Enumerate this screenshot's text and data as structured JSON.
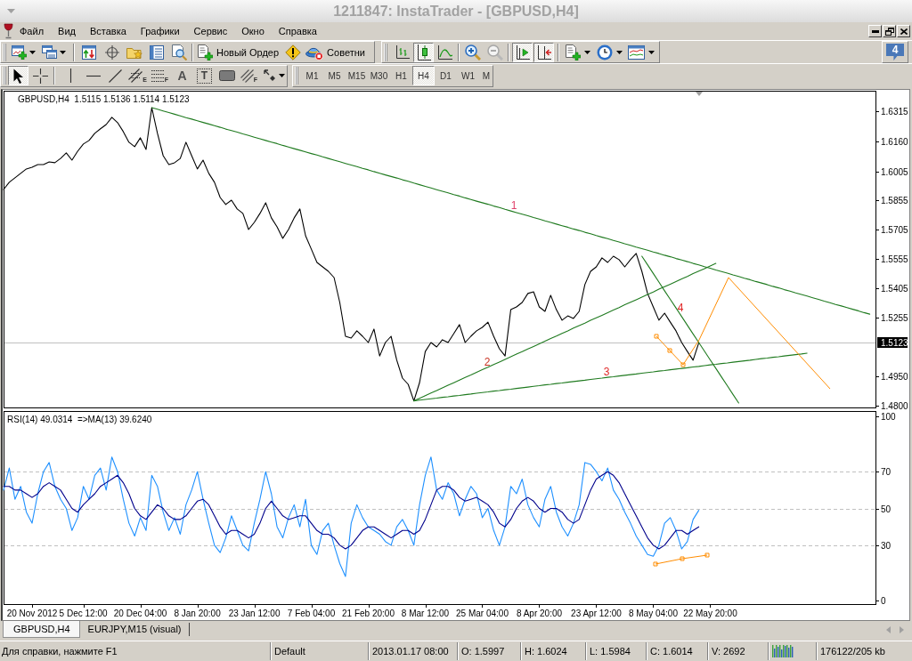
{
  "window": {
    "title": "1211847: InstaTrader - [GBPUSD,H4]"
  },
  "menu": [
    "Файл",
    "Вид",
    "Вставка",
    "Графики",
    "Сервис",
    "Окно",
    "Справка"
  ],
  "standard_toolbar": {
    "new_order": "Новый Ордер",
    "expert_advisors": "Советни"
  },
  "chart_toolbar": {
    "chart_types": [
      {
        "selected": false
      },
      {
        "selected": true
      },
      {
        "selected": false
      }
    ],
    "chart_shift": {
      "on": true
    },
    "autoscroll": {
      "on": true
    }
  },
  "notifications": {
    "count": "4"
  },
  "drawing_tools": [
    {
      "selected": true
    },
    {
      "selected": false
    },
    {
      "selected": false
    },
    {
      "selected": false
    },
    {
      "selected": false
    },
    {
      "selected": false,
      "glyph": "E"
    },
    {
      "selected": false,
      "glyph": "F"
    },
    {
      "selected": false,
      "glyph": "A"
    },
    {
      "selected": false,
      "glyph": "T"
    },
    {
      "selected": false
    },
    {
      "selected": false,
      "glyph": "F"
    },
    {
      "selected": false
    }
  ],
  "periods": [
    {
      "label": "M1",
      "selected": false
    },
    {
      "label": "M5",
      "selected": false
    },
    {
      "label": "M15",
      "selected": false
    },
    {
      "label": "M30",
      "selected": false
    },
    {
      "label": "H1",
      "selected": false
    },
    {
      "label": "H4",
      "selected": true
    },
    {
      "label": "D1",
      "selected": false
    },
    {
      "label": "W1",
      "selected": false
    },
    {
      "label": "M",
      "selected": false
    }
  ],
  "chart": {
    "chart_data": [
      {
        "type": "line",
        "title": "GBPUSD,H4  1.5115 1.5136 1.5114 1.5123",
        "ylim": [
          1.4791,
          1.642
        ],
        "yticks": [
          {
            "value": 1.48,
            "label": "1.4800"
          },
          {
            "value": 1.495,
            "label": "1.4950"
          },
          1.5255,
          1.5405,
          1.5555,
          1.5705,
          1.5855,
          1.6005,
          {
            "value": 1.616,
            "label": "1.6160"
          },
          1.6315
        ],
        "ref_lines": [
          {
            "axis": "y",
            "value": 1.5123,
            "label": "1.5123",
            "color": "#c0c0c0"
          }
        ],
        "annotations": [
          "1",
          "2",
          "3",
          "4"
        ],
        "categories": [
          null,
          null,
          null,
          null,
          null,
          null,
          null,
          null,
          null,
          null,
          null,
          null,
          null,
          null,
          null,
          null,
          null,
          null,
          null,
          null,
          null,
          null,
          null,
          null,
          null,
          null,
          null,
          null,
          null,
          null,
          null,
          null,
          null,
          null,
          null,
          null,
          null,
          null,
          null,
          null,
          null,
          null,
          null,
          null,
          null,
          null,
          null,
          null,
          null,
          null,
          null,
          null,
          null,
          null,
          null,
          null,
          null,
          null,
          null,
          null,
          null,
          null,
          null,
          null,
          null,
          null,
          null,
          null,
          null,
          null,
          null,
          null,
          null,
          null,
          null,
          null,
          null,
          null,
          null,
          null,
          null,
          null,
          null,
          null,
          null,
          null,
          null,
          null,
          null,
          null,
          null,
          null,
          null,
          null,
          null,
          null,
          null,
          null,
          null,
          null,
          null,
          null,
          null,
          null,
          null,
          null,
          null,
          null,
          null,
          null,
          null,
          null,
          null,
          null,
          null,
          null,
          null,
          null,
          null,
          null,
          null,
          null,
          null,
          null,
          null,
          null,
          null,
          null,
          null,
          null,
          null,
          null,
          null,
          null,
          null,
          null,
          null,
          null,
          null,
          null,
          null,
          null,
          null,
          null,
          null,
          null,
          null,
          null,
          null,
          null,
          null,
          null,
          null
        ],
        "series": [
          {
            "color": "#000000",
            "values": [
              1.5912,
              1.5949,
              1.5972,
              1.5995,
              1.6018,
              1.6027,
              1.604,
              1.604,
              1.6054,
              1.605,
              1.6072,
              1.61,
              1.6063,
              1.6109,
              1.6146,
              1.6164,
              1.6201,
              1.6224,
              1.6246,
              1.6283,
              1.6256,
              1.621,
              1.6155,
              1.6132,
              1.6178,
              1.6118,
              1.6333,
              1.6201,
              1.6086,
              1.604,
              1.605,
              1.6072,
              1.6155,
              1.6086,
              1.6018,
              1.6063,
              1.5995,
              1.5949,
              1.5871,
              1.5835,
              1.5857,
              1.5812,
              1.5789,
              1.5706,
              1.5743,
              1.5789,
              1.5844,
              1.5766,
              1.572,
              1.5661,
              1.5706,
              1.5766,
              1.5812,
              1.5674,
              1.5606,
              1.5537,
              1.5514,
              1.5491,
              1.5459,
              1.5331,
              1.5157,
              1.5148,
              1.5185,
              1.5157,
              1.5125,
              1.5194,
              1.5056,
              1.5125,
              1.5157,
              1.5034,
              1.4942,
              1.491,
              1.4825,
              1.4919,
              1.5079,
              1.5125,
              1.5102,
              1.5139,
              1.5125,
              1.5171,
              1.5217,
              1.5125,
              1.5157,
              1.5185,
              1.5203,
              1.523,
              1.5157,
              1.5093,
              1.5056,
              1.5294,
              1.5308,
              1.5331,
              1.5377,
              1.5386,
              1.5308,
              1.5285,
              1.5368,
              1.5294,
              1.524,
              1.5262,
              1.5249,
              1.5285,
              1.5423,
              1.5491,
              1.5514,
              1.556,
              1.5537,
              1.5569,
              1.5551,
              1.5514,
              1.5551,
              1.5583,
              1.5491,
              1.5377,
              1.5308,
              1.524,
              1.5276,
              1.523,
              1.5185,
              1.5125,
              1.5079,
              1.5034,
              1.5123,
              null,
              null,
              null,
              null,
              null,
              null,
              null,
              null,
              null,
              null,
              null,
              null,
              null,
              null,
              null,
              null,
              null,
              null,
              null,
              null,
              null,
              null,
              null,
              null,
              null,
              null,
              null,
              null,
              null,
              null
            ]
          },
          {
            "type": "line",
            "color": "#1f7a1f",
            "values": [
              null,
              null,
              null,
              null,
              null,
              null,
              null,
              null,
              null,
              null,
              null,
              null,
              null,
              null,
              null,
              null,
              null,
              null,
              null,
              null,
              null,
              null,
              null,
              null,
              null,
              null,
              1.6333,
              1.6325,
              1.6316,
              1.6308,
              1.6299,
              1.6291,
              1.6282,
              1.6274,
              1.6266,
              1.6257,
              1.6249,
              1.624,
              1.6232,
              1.6223,
              1.6215,
              1.6207,
              1.6198,
              1.619,
              1.6181,
              1.6173,
              1.6164,
              1.6156,
              1.6148,
              1.6139,
              1.6131,
              1.6122,
              1.6114,
              1.6105,
              1.6097,
              1.6089,
              1.608,
              1.6072,
              1.6063,
              1.6055,
              1.6046,
              1.6038,
              1.603,
              1.6021,
              1.6013,
              1.6004,
              1.5996,
              1.5987,
              1.5979,
              1.5971,
              1.5962,
              1.5954,
              1.5945,
              1.5937,
              1.5928,
              1.592,
              1.5911,
              1.5903,
              1.5895,
              1.5886,
              1.5878,
              1.5869,
              1.5861,
              1.5852,
              1.5844,
              1.5836,
              1.5827,
              1.5819,
              1.581,
              1.5802,
              1.5793,
              1.5785,
              1.5777,
              1.5768,
              1.576,
              1.5751,
              1.5743,
              1.5734,
              1.5726,
              1.5718,
              1.5709,
              1.5701,
              1.5692,
              1.5684,
              1.5675,
              1.5667,
              1.5659,
              1.565,
              1.5642,
              1.5633,
              1.5625,
              1.5616,
              1.5608,
              1.56,
              1.5591,
              1.5583,
              1.5574,
              1.5566,
              1.5557,
              1.5549,
              1.5541,
              1.5532,
              1.5524,
              1.5515,
              1.5507,
              1.5498,
              1.549,
              1.5482,
              1.5473,
              1.5465,
              1.5456,
              1.5448,
              1.5439,
              1.5431,
              1.5423,
              1.5414,
              1.5406,
              1.5397,
              1.5389,
              1.538,
              1.5372,
              1.5364,
              1.5355,
              1.5347,
              1.5338,
              1.533,
              1.5321,
              1.5313,
              1.5305,
              1.5296,
              1.5288,
              1.5279,
              1.5271
            ]
          },
          {
            "type": "line",
            "color": "#1f7a1f",
            "values": [
              null,
              null,
              null,
              null,
              null,
              null,
              null,
              null,
              null,
              null,
              null,
              null,
              null,
              null,
              null,
              null,
              null,
              null,
              null,
              null,
              null,
              null,
              null,
              null,
              null,
              null,
              null,
              null,
              null,
              null,
              null,
              null,
              null,
              null,
              null,
              null,
              null,
              null,
              null,
              null,
              null,
              null,
              null,
              null,
              null,
              null,
              null,
              null,
              null,
              null,
              null,
              null,
              null,
              null,
              null,
              null,
              null,
              null,
              null,
              null,
              null,
              null,
              null,
              null,
              null,
              null,
              null,
              null,
              null,
              null,
              null,
              null,
              1.4825,
              1.4838,
              1.4852,
              1.4865,
              1.4878,
              1.4892,
              1.4905,
              1.4918,
              1.4932,
              1.4945,
              1.4958,
              1.4972,
              1.4985,
              1.4998,
              1.5012,
              1.5025,
              1.5038,
              1.5052,
              1.5065,
              1.5078,
              1.5092,
              1.5105,
              1.5118,
              1.5132,
              1.5145,
              1.5158,
              1.5172,
              1.5185,
              1.5199,
              1.5212,
              1.5225,
              1.5239,
              1.5252,
              1.5265,
              1.5279,
              1.5292,
              1.5305,
              1.5319,
              1.5332,
              1.5345,
              1.5359,
              1.5372,
              1.5385,
              1.5399,
              1.5412,
              1.5425,
              1.5439,
              1.5452,
              1.5465,
              1.5479,
              1.5492,
              1.5505,
              1.5519,
              1.5532,
              null,
              null,
              null,
              null,
              null,
              null,
              null,
              null,
              null,
              null,
              null,
              null,
              null,
              null,
              null,
              null,
              null,
              null,
              null,
              null,
              null,
              null,
              null,
              null,
              null,
              null,
              null
            ]
          },
          {
            "type": "line",
            "color": "#1f7a1f",
            "values": [
              null,
              null,
              null,
              null,
              null,
              null,
              null,
              null,
              null,
              null,
              null,
              null,
              null,
              null,
              null,
              null,
              null,
              null,
              null,
              null,
              null,
              null,
              null,
              null,
              null,
              null,
              null,
              null,
              null,
              null,
              null,
              null,
              null,
              null,
              null,
              null,
              null,
              null,
              null,
              null,
              null,
              null,
              null,
              null,
              null,
              null,
              null,
              null,
              null,
              null,
              null,
              null,
              null,
              null,
              null,
              null,
              null,
              null,
              null,
              null,
              null,
              null,
              null,
              null,
              null,
              null,
              null,
              null,
              null,
              null,
              null,
              null,
              1.4825,
              1.4829,
              1.4832,
              1.4836,
              1.4839,
              1.4843,
              1.4846,
              1.485,
              1.4853,
              1.4857,
              1.486,
              1.4864,
              1.4868,
              1.4871,
              1.4875,
              1.4878,
              1.4882,
              1.4885,
              1.4889,
              1.4892,
              1.4896,
              1.49,
              1.4903,
              1.4907,
              1.491,
              1.4914,
              1.4917,
              1.4921,
              1.4924,
              1.4928,
              1.4931,
              1.4935,
              1.4939,
              1.4942,
              1.4946,
              1.4949,
              1.4953,
              1.4956,
              1.496,
              1.4963,
              1.4967,
              1.4971,
              1.4974,
              1.4978,
              1.4981,
              1.4985,
              1.4988,
              1.4992,
              1.4995,
              1.4999,
              1.5002,
              1.5006,
              1.501,
              1.5013,
              1.5017,
              1.502,
              1.5024,
              1.5027,
              1.5031,
              1.5034,
              1.5038,
              1.5042,
              1.5045,
              1.5049,
              1.5052,
              1.5056,
              1.5059,
              1.5063,
              1.5066,
              1.507,
              null,
              null,
              null,
              null,
              null,
              null,
              null,
              null,
              null,
              null,
              null
            ]
          },
          {
            "type": "line",
            "color": "#1f7a1f",
            "values": [
              null,
              null,
              null,
              null,
              null,
              null,
              null,
              null,
              null,
              null,
              null,
              null,
              null,
              null,
              null,
              null,
              null,
              null,
              null,
              null,
              null,
              null,
              null,
              null,
              null,
              null,
              null,
              null,
              null,
              null,
              null,
              null,
              null,
              null,
              null,
              null,
              null,
              null,
              null,
              null,
              null,
              null,
              null,
              null,
              null,
              null,
              null,
              null,
              null,
              null,
              null,
              null,
              null,
              null,
              null,
              null,
              null,
              null,
              null,
              null,
              null,
              null,
              null,
              null,
              null,
              null,
              null,
              null,
              null,
              null,
              null,
              null,
              null,
              null,
              null,
              null,
              null,
              null,
              null,
              null,
              null,
              null,
              null,
              null,
              null,
              null,
              null,
              null,
              null,
              null,
              null,
              null,
              null,
              null,
              null,
              null,
              null,
              null,
              null,
              null,
              null,
              null,
              null,
              null,
              null,
              null,
              null,
              null,
              null,
              null,
              null,
              null,
              1.5569,
              1.5525,
              1.548,
              1.5436,
              1.5391,
              1.5347,
              1.5303,
              1.5258,
              1.5214,
              1.5169,
              1.5125,
              1.508,
              1.5036,
              1.4992,
              1.4947,
              1.4903,
              1.4858,
              1.4814,
              null,
              null,
              null,
              null,
              null,
              null,
              null,
              null,
              null,
              null,
              null,
              null,
              null,
              null,
              null,
              null,
              null,
              null,
              null,
              null,
              null,
              null,
              null
            ]
          }
        ]
      },
      {
        "type": "line",
        "title": "RSI(14) 49.0314  =>MA(13) 39.6240",
        "ylim": [
          -2,
          103
        ],
        "yticks": [
          0,
          30,
          50,
          70,
          100
        ],
        "ref_lines": [
          {
            "axis": "y",
            "value": 30,
            "color": "#c0c0c0",
            "line_style": "dashed"
          },
          {
            "axis": "y",
            "value": 50,
            "color": "#c0c0c0",
            "line_style": "dashed"
          },
          {
            "axis": "y",
            "value": 70,
            "color": "#c0c0c0",
            "line_style": "dashed"
          }
        ],
        "categories": [
          null,
          null,
          null,
          null,
          null,
          "20 Nov 2012",
          null,
          null,
          null,
          null,
          null,
          null,
          null,
          null,
          "5 Dec 12:00",
          null,
          null,
          null,
          null,
          null,
          null,
          null,
          null,
          null,
          "20 Dec 04:00",
          null,
          null,
          null,
          null,
          null,
          null,
          null,
          null,
          null,
          "8 Jan 20:00",
          null,
          null,
          null,
          null,
          null,
          null,
          null,
          null,
          null,
          "23 Jan 12:00",
          null,
          null,
          null,
          null,
          null,
          null,
          null,
          null,
          null,
          "7 Feb 04:00",
          null,
          null,
          null,
          null,
          null,
          null,
          null,
          null,
          null,
          "21 Feb 20:00",
          null,
          null,
          null,
          null,
          null,
          null,
          null,
          null,
          null,
          "8 Mar 12:00",
          null,
          null,
          null,
          null,
          null,
          null,
          null,
          null,
          null,
          "25 Mar 04:00",
          null,
          null,
          null,
          null,
          null,
          null,
          null,
          null,
          null,
          "8 Apr 20:00",
          null,
          null,
          null,
          null,
          null,
          null,
          null,
          null,
          null,
          "23 Apr 12:00",
          null,
          null,
          null,
          null,
          null,
          null,
          null,
          null,
          null,
          "8 May 04:00",
          null,
          null,
          null,
          null,
          null,
          null,
          null,
          null,
          null,
          "22 May 20:00",
          null,
          null,
          null,
          null,
          null,
          null,
          null,
          null,
          null,
          null,
          null,
          null,
          null,
          null,
          null,
          null,
          null,
          null,
          null,
          null,
          null,
          null,
          null,
          null,
          null,
          null,
          null,
          null
        ],
        "series": [
          {
            "color": "#1e90ff",
            "values": [
              60,
              72,
              55,
              62,
              48,
              42,
              58,
              70,
              75,
              62,
              55,
              50,
              38,
              45,
              62,
              55,
              68,
              72,
              60,
              78,
              70,
              55,
              42,
              35,
              45,
              38,
              68,
              62,
              48,
              38,
              45,
              36,
              52,
              60,
              70,
              55,
              42,
              30,
              26,
              34,
              46,
              38,
              30,
              27,
              42,
              55,
              70,
              58,
              40,
              34,
              45,
              52,
              40,
              55,
              30,
              25,
              38,
              42,
              30,
              20,
              13,
              42,
              52,
              45,
              40,
              38,
              36,
              32,
              30,
              40,
              44,
              38,
              30,
              52,
              68,
              78,
              60,
              55,
              64,
              58,
              46,
              55,
              62,
              58,
              45,
              50,
              38,
              30,
              40,
              62,
              58,
              66,
              52,
              45,
              40,
              55,
              62,
              48,
              40,
              35,
              42,
              52,
              75,
              74,
              70,
              65,
              72,
              60,
              55,
              48,
              42,
              35,
              30,
              25,
              24,
              30,
              42,
              45,
              38,
              28,
              32,
              44,
              49,
              null,
              null,
              null,
              null,
              null,
              null,
              null,
              null,
              null,
              null,
              null,
              null,
              null,
              null,
              null,
              null,
              null,
              null,
              null,
              null,
              null,
              null,
              null,
              null,
              null,
              null,
              null,
              null,
              null,
              null
            ]
          },
          {
            "color": "#00008b",
            "values": [
              62,
              62,
              60,
              60,
              58,
              56,
              58,
              62,
              64,
              62,
              60,
              55,
              50,
              48,
              52,
              55,
              58,
              62,
              64,
              66,
              68,
              64,
              58,
              50,
              46,
              44,
              48,
              52,
              50,
              46,
              44,
              44,
              46,
              50,
              54,
              55,
              52,
              46,
              40,
              36,
              38,
              38,
              36,
              34,
              36,
              42,
              50,
              54,
              50,
              46,
              44,
              45,
              46,
              46,
              42,
              38,
              36,
              36,
              34,
              30,
              28,
              30,
              34,
              38,
              40,
              40,
              38,
              36,
              34,
              36,
              38,
              38,
              36,
              38,
              44,
              52,
              60,
              62,
              62,
              60,
              56,
              54,
              55,
              56,
              54,
              52,
              48,
              42,
              40,
              44,
              50,
              54,
              56,
              54,
              50,
              48,
              50,
              50,
              48,
              44,
              42,
              44,
              52,
              60,
              66,
              68,
              70,
              68,
              64,
              58,
              52,
              46,
              40,
              34,
              30,
              28,
              30,
              34,
              38,
              38,
              36,
              38,
              40,
              null,
              null,
              null,
              null,
              null,
              null,
              null,
              null,
              null,
              null,
              null,
              null,
              null,
              null,
              null,
              null,
              null,
              null,
              null,
              null,
              null,
              null,
              null,
              null,
              null,
              null,
              null,
              null,
              null,
              null
            ]
          }
        ]
      }
    ]
  },
  "chart_tabs": [
    {
      "label": "GBPUSD,H4",
      "selected": true
    },
    {
      "label": "EURJPY,M15 (visual)",
      "selected": false
    }
  ],
  "status_bar": {
    "help": "Для справки, нажмите F1",
    "profile": "Default",
    "time": "2013.01.17 08:00",
    "open": "O: 1.5997",
    "high": "H: 1.6024",
    "low": "L: 1.5984",
    "close": "C: 1.6014",
    "volume": "V: 2692",
    "traffic": "176122/205 kb"
  }
}
